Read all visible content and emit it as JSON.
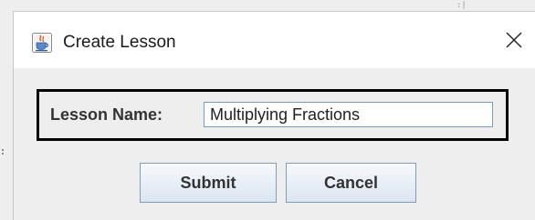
{
  "dialog": {
    "title": "Create Lesson",
    "app_icon": "java-coffee-cup-icon",
    "close_icon": "close-icon"
  },
  "form": {
    "lesson_name_label": "Lesson Name:",
    "lesson_name_value": "Multiplying Fractions"
  },
  "buttons": {
    "submit_label": "Submit",
    "cancel_label": "Cancel"
  },
  "colors": {
    "panel_border": "#000000",
    "button_border": "#7f9db9",
    "input_border": "#7a9bc4",
    "titlebar_bg": "#ffffff",
    "content_bg": "#eeeeee"
  }
}
